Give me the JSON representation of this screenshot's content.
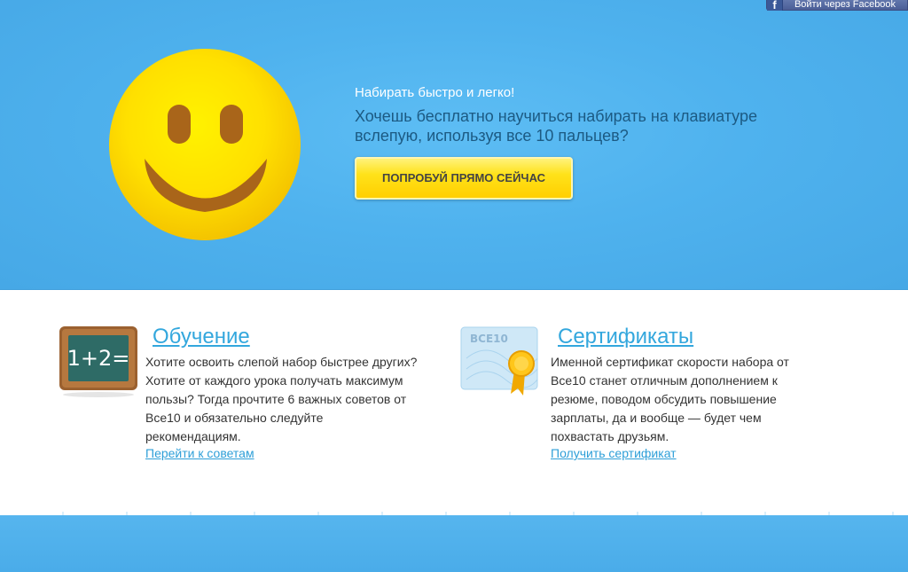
{
  "header": {
    "facebook_login": "Войти через Facebook"
  },
  "hero": {
    "subtitle": "Набирать быстро и легко!",
    "title": "Хочешь бесплатно научиться набирать на клавиатуре вслепую, используя все 10 пальцев?",
    "cta_label": "ПОПРОБУЙ ПРЯМО СЕЙЧАС"
  },
  "blocks": [
    {
      "title": "Обучение",
      "icon": "chalkboard-icon",
      "icon_text": "1+2=",
      "description": "Хотите освоить слепой набор быстрее других? Хотите от каждого урока получать максимум пользы? Тогда прочтите 6 важных советов от Все10 и обязательно следуйте рекомендациям.",
      "link": "Перейти к советам"
    },
    {
      "title": "Сертификаты",
      "icon": "certificate-icon",
      "icon_text": "ВСЕ10",
      "description": "Именной сертификат скорости набора от Все10 станет отличным дополнением к резюме, поводом обсудить повышение зарплаты, да и вообще — будет чем похвастать друзьям.",
      "link": "Получить сертификат"
    }
  ],
  "colors": {
    "hero_blue": "#4fb2ee",
    "link_blue": "#2e9fd8",
    "cta_yellow": "#ffe21a",
    "smiley_yellow": "#ffe600"
  }
}
